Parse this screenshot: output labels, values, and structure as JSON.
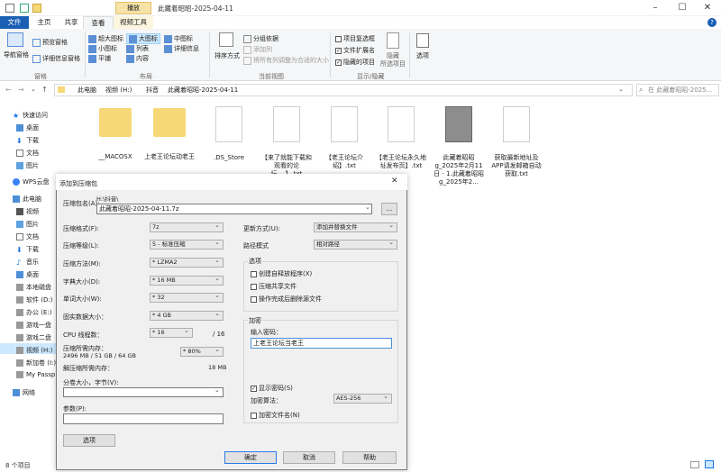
{
  "window": {
    "title": "此藏着昭昭-2025-04-11",
    "play_tab": "播放"
  },
  "tabs": {
    "file": "文件",
    "home": "主页",
    "share": "共享",
    "view": "查看",
    "video": "视频工具"
  },
  "ribbon": {
    "nav_pane": "导航窗格",
    "preview": "预览窗格",
    "details_pane": "详细信息窗格",
    "xl_icons": "超大图标",
    "l_icons": "大图标",
    "m_icons": "中图标",
    "s_icons": "小图标",
    "list": "列表",
    "details": "详细信息",
    "tiles": "平铺",
    "content": "内容",
    "sort": "排序方式",
    "group_by": "分组依据",
    "add_col": "添加列",
    "fit_cols": "将所有列调整为合适的大小",
    "item_check": "项目复选框",
    "ext": "文件扩展名",
    "hidden": "隐藏的项目",
    "hide": "隐藏",
    "selected": "所选项目",
    "options": "选项",
    "group_pane": "窗格",
    "group_layout": "布局",
    "group_view": "当前视图",
    "group_showhide": "显示/隐藏"
  },
  "address": {
    "crumbs": [
      "此电脑",
      "视频 (H:)",
      "抖音",
      "此藏着昭昭-2025-04-11"
    ],
    "search_placeholder": "在 此藏着昭昭-2025..."
  },
  "nav": {
    "quick": "快速访问",
    "desktop": "桌面",
    "downloads": "下载",
    "docs": "文档",
    "pics": "图片",
    "wps": "WPS云盘",
    "pc": "此电脑",
    "video": "视频",
    "pics2": "图片",
    "docs2": "文档",
    "dl2": "下载",
    "music": "音乐",
    "desk2": "桌面",
    "local": "本地磁盘",
    "soft": "软件 (D:)",
    "office": "办公 (E:)",
    "game1": "游戏一盘",
    "game2": "游戏二盘",
    "videoH": "视频 (H:)",
    "newvol": "新加卷 (I:)",
    "passport": "My Passp",
    "network": "网络"
  },
  "files": [
    {
      "name": "__MACOSX"
    },
    {
      "name": "上老王论坛动老王"
    },
    {
      "name": ".DS_Store"
    },
    {
      "name": "【来了就能下载和观看的论坛,...】.txt"
    },
    {
      "name": "【老王论坛介绍】.txt"
    },
    {
      "name": "【老王论坛永久地址发布页】.txt"
    },
    {
      "name": "此藏着昭昭g_2025年2月11日 - 1.此藏着昭昭g_2025年2..."
    },
    {
      "name": "获取最新地址及APP请发邮箱自动获取.txt"
    }
  ],
  "status": {
    "count": "8 个项目"
  },
  "dialog": {
    "title": "添加到压缩包",
    "archive_label": "压缩包名(A):",
    "archive_path": "H:\\抖音\\",
    "archive_name": "此藏着昭昭-2025-04-11.7z",
    "browse": "...",
    "format_label": "压缩格式(F):",
    "format_value": "7z",
    "level_label": "压缩等级(L):",
    "level_value": "5 - 标准压缩",
    "method_label": "压缩方法(M):",
    "method_value": "* LZMA2",
    "dict_label": "字典大小(D):",
    "dict_value": "* 16 MB",
    "word_label": "单词大小(W):",
    "word_value": "* 32",
    "solid_label": "固实数据大小：",
    "solid_value": "* 4 GB",
    "threads_label": "CPU 线程数：",
    "threads_value": "* 16",
    "threads_max": "/ 16",
    "mem_label": "压缩所需内存：",
    "mem_value": "2496 MB / 51 GB / 64 GB",
    "mem_pct": "* 80%",
    "decomp_label": "解压缩所需内存：",
    "decomp_value": "18 MB",
    "split_label": "分卷大小，字节(V):",
    "params_label": "参数(P):",
    "options_btn": "选项",
    "update_label": "更新方式(U):",
    "update_value": "添加并替换文件",
    "path_label": "路径模式",
    "path_value": "相对路径",
    "opts_group": "选项",
    "opt_sfx": "创建自释放程序(X)",
    "opt_shared": "压缩共享文件",
    "opt_delete": "操作完成后删除源文件",
    "enc_group": "加密",
    "pwd_label": "输入密码：",
    "pwd_value": "上老王论坛当老王",
    "show_pwd": "显示密码(S)",
    "enc_method_label": "加密算法：",
    "enc_method_value": "AES-256",
    "enc_names": "加密文件名(N)",
    "ok": "确定",
    "cancel": "取消",
    "help": "帮助"
  }
}
